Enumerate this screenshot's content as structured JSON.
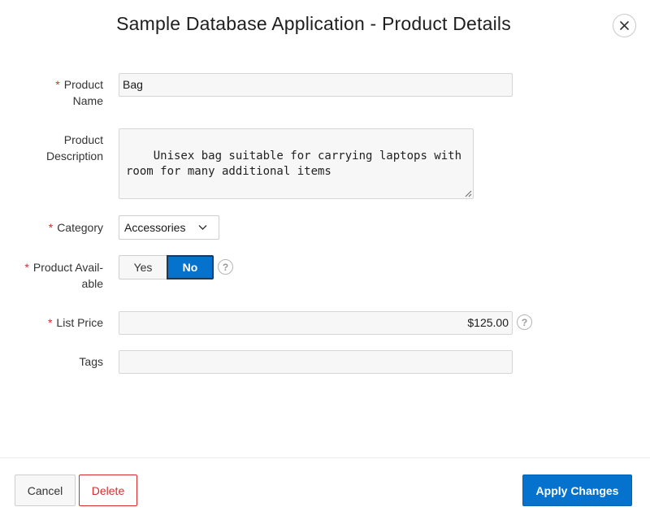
{
  "dialog": {
    "title": "Sample Database Application - Product Details"
  },
  "form": {
    "required_marker": "*",
    "product_name": {
      "label_line1": "Product",
      "label_line2": "Name",
      "value": "Bag",
      "required": true
    },
    "product_description": {
      "label_line1": "Product",
      "label_line2": "Description",
      "value": "Unisex bag suitable for carrying laptops with\nroom for many additional items",
      "required": false
    },
    "category": {
      "label": "Category",
      "value": "Accessories",
      "required": true
    },
    "product_available": {
      "label_line1": "Product Avail-",
      "label_line2": "able",
      "options": [
        "Yes",
        "No"
      ],
      "selected": "No",
      "required": true,
      "help_icon": "question-circle-icon",
      "help_glyph": "?"
    },
    "list_price": {
      "label": "List Price",
      "value": "$125.00",
      "required": true,
      "help_icon": "question-circle-icon",
      "help_glyph": "?"
    },
    "tags": {
      "label": "Tags",
      "value": "",
      "required": false
    }
  },
  "footer": {
    "cancel_label": "Cancel",
    "delete_label": "Delete",
    "apply_label": "Apply Changes"
  },
  "colors": {
    "accent": "#0572ce",
    "required": "#d42d2d",
    "danger": "#d42d2d",
    "field_bg": "#f7f7f7"
  }
}
